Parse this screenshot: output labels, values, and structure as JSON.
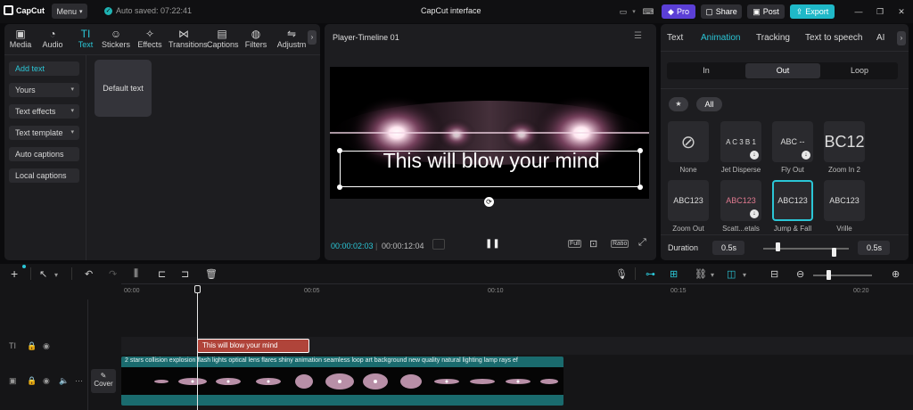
{
  "app": {
    "logo": "CapCut",
    "menu": "Menu",
    "autosave": "Auto saved: 07:22:41",
    "title": "CapCut interface",
    "pro": "Pro",
    "share": "Share",
    "post": "Post",
    "export": "Export"
  },
  "left_tabs": [
    {
      "label": "Media",
      "icon": "media-icon",
      "glyph": "▣"
    },
    {
      "label": "Audio",
      "icon": "audio-icon",
      "glyph": "◔"
    },
    {
      "label": "Text",
      "icon": "text-icon",
      "glyph": "TI"
    },
    {
      "label": "Stickers",
      "icon": "stickers-icon",
      "glyph": "☺"
    },
    {
      "label": "Effects",
      "icon": "effects-icon",
      "glyph": "✧"
    },
    {
      "label": "Transitions",
      "icon": "transitions-icon",
      "glyph": "⋈"
    },
    {
      "label": "Captions",
      "icon": "captions-icon",
      "glyph": "▤"
    },
    {
      "label": "Filters",
      "icon": "filters-icon",
      "glyph": "◍"
    },
    {
      "label": "Adjustm",
      "icon": "adjust-icon",
      "glyph": "⇋"
    }
  ],
  "left_sidebar": [
    "Add text",
    "Yours",
    "Text effects",
    "Text template",
    "Auto captions",
    "Local captions"
  ],
  "default_text": "Default text",
  "player": {
    "title": "Player-Timeline 01",
    "overlay_text": "This will blow your mind",
    "current": "00:00:02:03",
    "total": "00:00:12:04",
    "full": "Full",
    "ratio": "Ratio"
  },
  "right_tabs": [
    "Text",
    "Animation",
    "Tracking",
    "Text to speech",
    "AI"
  ],
  "anim_segments": [
    "In",
    "Out",
    "Loop"
  ],
  "anim_filter_all": "All",
  "animations": [
    {
      "label": "None",
      "preview": ""
    },
    {
      "label": "Jet Disperse",
      "preview": "A C 3 B 1"
    },
    {
      "label": "Fly Out",
      "preview": "ABC --"
    },
    {
      "label": "Zoom In 2",
      "preview": "BC12"
    },
    {
      "label": "Zoom Out",
      "preview": "ABC123"
    },
    {
      "label": "Scatt...etals",
      "preview": "ABC123"
    },
    {
      "label": "Jump & Fall",
      "preview": "ABC123"
    },
    {
      "label": "Vrille",
      "preview": "ABC123"
    }
  ],
  "duration": {
    "label": "Duration",
    "left": "0.5s",
    "right": "0.5s"
  },
  "ruler": [
    "00:00",
    "00:05",
    "00:10",
    "00:15",
    "00:20"
  ],
  "text_clip": "This will blow your mind",
  "video_clip": "2 stars collision explosion flash lights optical lens flares shiny animation seamless loop art background new quality natural lighting lamp rays ef",
  "cover": "Cover",
  "colors": {
    "accent": "#1fc2c2",
    "text_clip": "#b0443a",
    "video_track": "#1a6b6e"
  }
}
